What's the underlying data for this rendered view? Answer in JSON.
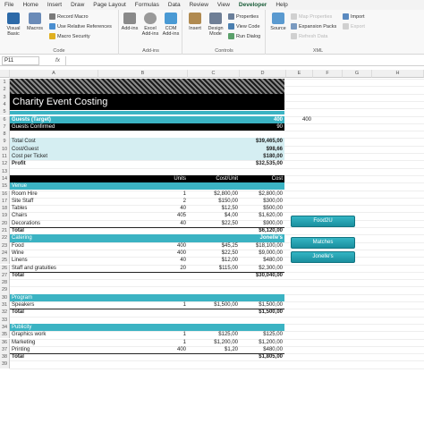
{
  "menu": [
    "File",
    "Home",
    "Insert",
    "Draw",
    "Page Layout",
    "Formulas",
    "Data",
    "Review",
    "View",
    "Developer",
    "Help"
  ],
  "active_menu": "Developer",
  "ribbon": {
    "code": {
      "label": "Code",
      "visual_basic": "Visual Basic",
      "macros": "Macros",
      "record_macro": "Record Macro",
      "relative_refs": "Use Relative References",
      "macro_security": "Macro Security"
    },
    "addins": {
      "label": "Add-ins",
      "addins": "Add-ins",
      "excel_addins": "Excel Add-ins",
      "com_addins": "COM Add-ins"
    },
    "controls": {
      "label": "Controls",
      "insert": "Insert",
      "design_mode": "Design Mode",
      "properties": "Properties",
      "view_code": "View Code",
      "run_dialog": "Run Dialog"
    },
    "xml": {
      "label": "XML",
      "source": "Source",
      "map_properties": "Map Properties",
      "expansion_packs": "Expansion Packs",
      "refresh_data": "Refresh Data",
      "import": "Import",
      "export": "Export"
    }
  },
  "formula_bar": {
    "name_box": "P11",
    "fx": "fx"
  },
  "columns": [
    "A",
    "B",
    "C",
    "D",
    "E",
    "F",
    "G",
    "H"
  ],
  "sheet": {
    "title": "Charity Event Costing",
    "guests_target_label": "Guests (Target)",
    "guests_target_value": "400",
    "guests_target_side": "400",
    "guests_confirmed_label": "Guests Confirmed",
    "guests_confirmed_value": "90",
    "total_cost_label": "Total Cost",
    "total_cost_value": "$39,465,00",
    "cost_guest_label": "Cost/Guest",
    "cost_guest_value": "$98,66",
    "cost_ticket_label": "Cost per Ticket",
    "cost_ticket_value": "$180,00",
    "profit_label": "Profit",
    "profit_value": "$32,535,00",
    "hdr_units": "Units",
    "hdr_cost_unit": "Cost/Unit",
    "hdr_cost": "Cost"
  },
  "sections": [
    {
      "title": "Venue",
      "right": "",
      "rows": [
        {
          "item": "Room Hire",
          "units": "1",
          "unit": "$2,800,00",
          "cost": "$2,800,00"
        },
        {
          "item": "Site Staff",
          "units": "2",
          "unit": "$150,00",
          "cost": "$300,00"
        },
        {
          "item": "Tables",
          "units": "40",
          "unit": "$12,50",
          "cost": "$500,00"
        },
        {
          "item": "Chairs",
          "units": "405",
          "unit": "$4,00",
          "cost": "$1,620,00"
        },
        {
          "item": "Decorations",
          "units": "40",
          "unit": "$22,50",
          "cost": "$900,00"
        }
      ],
      "total_label": "Total",
      "total": "$6,120,00"
    },
    {
      "title": "Catering",
      "right": "Jonelle's",
      "rows": [
        {
          "item": "Food",
          "units": "400",
          "unit": "$45,25",
          "cost": "$18,100,00"
        },
        {
          "item": "Wine",
          "units": "400",
          "unit": "$22,50",
          "cost": "$9,000,00"
        },
        {
          "item": "Linens",
          "units": "40",
          "unit": "$12,00",
          "cost": "$480,00"
        },
        {
          "item": "Staff and gratuities",
          "units": "20",
          "unit": "$115,00",
          "cost": "$2,300,00"
        }
      ],
      "total_label": "Total",
      "total": "$30,040,00"
    },
    {
      "title": "Program",
      "right": "",
      "rows": [
        {
          "item": "Speakers",
          "units": "1",
          "unit": "$1,500,00",
          "cost": "$1,500,00"
        }
      ],
      "total_label": "Total",
      "total": "$1,500,00"
    },
    {
      "title": "Publicity",
      "right": "",
      "rows": [
        {
          "item": "Graphics work",
          "units": "1",
          "unit": "$125,00",
          "cost": "$125,00"
        },
        {
          "item": "Marketing",
          "units": "1",
          "unit": "$1,200,00",
          "cost": "$1,200,00"
        },
        {
          "item": "Printing",
          "units": "400",
          "unit": "$1,20",
          "cost": "$480,00"
        }
      ],
      "total_label": "Total",
      "total": "$1,805,00"
    }
  ],
  "buttons": [
    "Food2U",
    "Matches",
    "Jonelle's"
  ],
  "colors": {
    "teal": "#3bb3c3",
    "teal_light": "#d5eef2",
    "black": "#000000",
    "developer_green": "#185c37"
  }
}
